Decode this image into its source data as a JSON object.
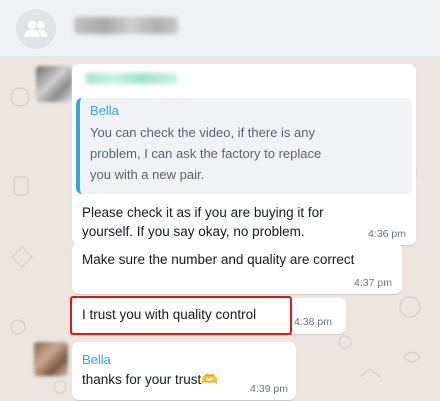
{
  "header": {
    "group_icon": "group-icon"
  },
  "messages": [
    {
      "quote_author": "Bella",
      "quote_lines": [
        "You can check the video, if there is any",
        "problem, I can ask the factory to replace",
        "you with a new pair."
      ],
      "lines": [
        "Please check it as if you are buying it for",
        "yourself. If you say okay, no problem."
      ],
      "time": "4:36 pm"
    },
    {
      "text": "Make sure the number and quality are correct",
      "time": "4:37 pm"
    },
    {
      "text": "I trust you with quality control",
      "time": "4:38 pm",
      "highlight_color": "#e0171d"
    },
    {
      "sender": "Bella",
      "text": "thanks for your trust🫶",
      "time": "4:39 pm"
    }
  ],
  "colors": {
    "chat_background": "#ece6df",
    "bubble": "#ffffff",
    "accent": "#35a6cf",
    "header": "#eff2f5"
  }
}
